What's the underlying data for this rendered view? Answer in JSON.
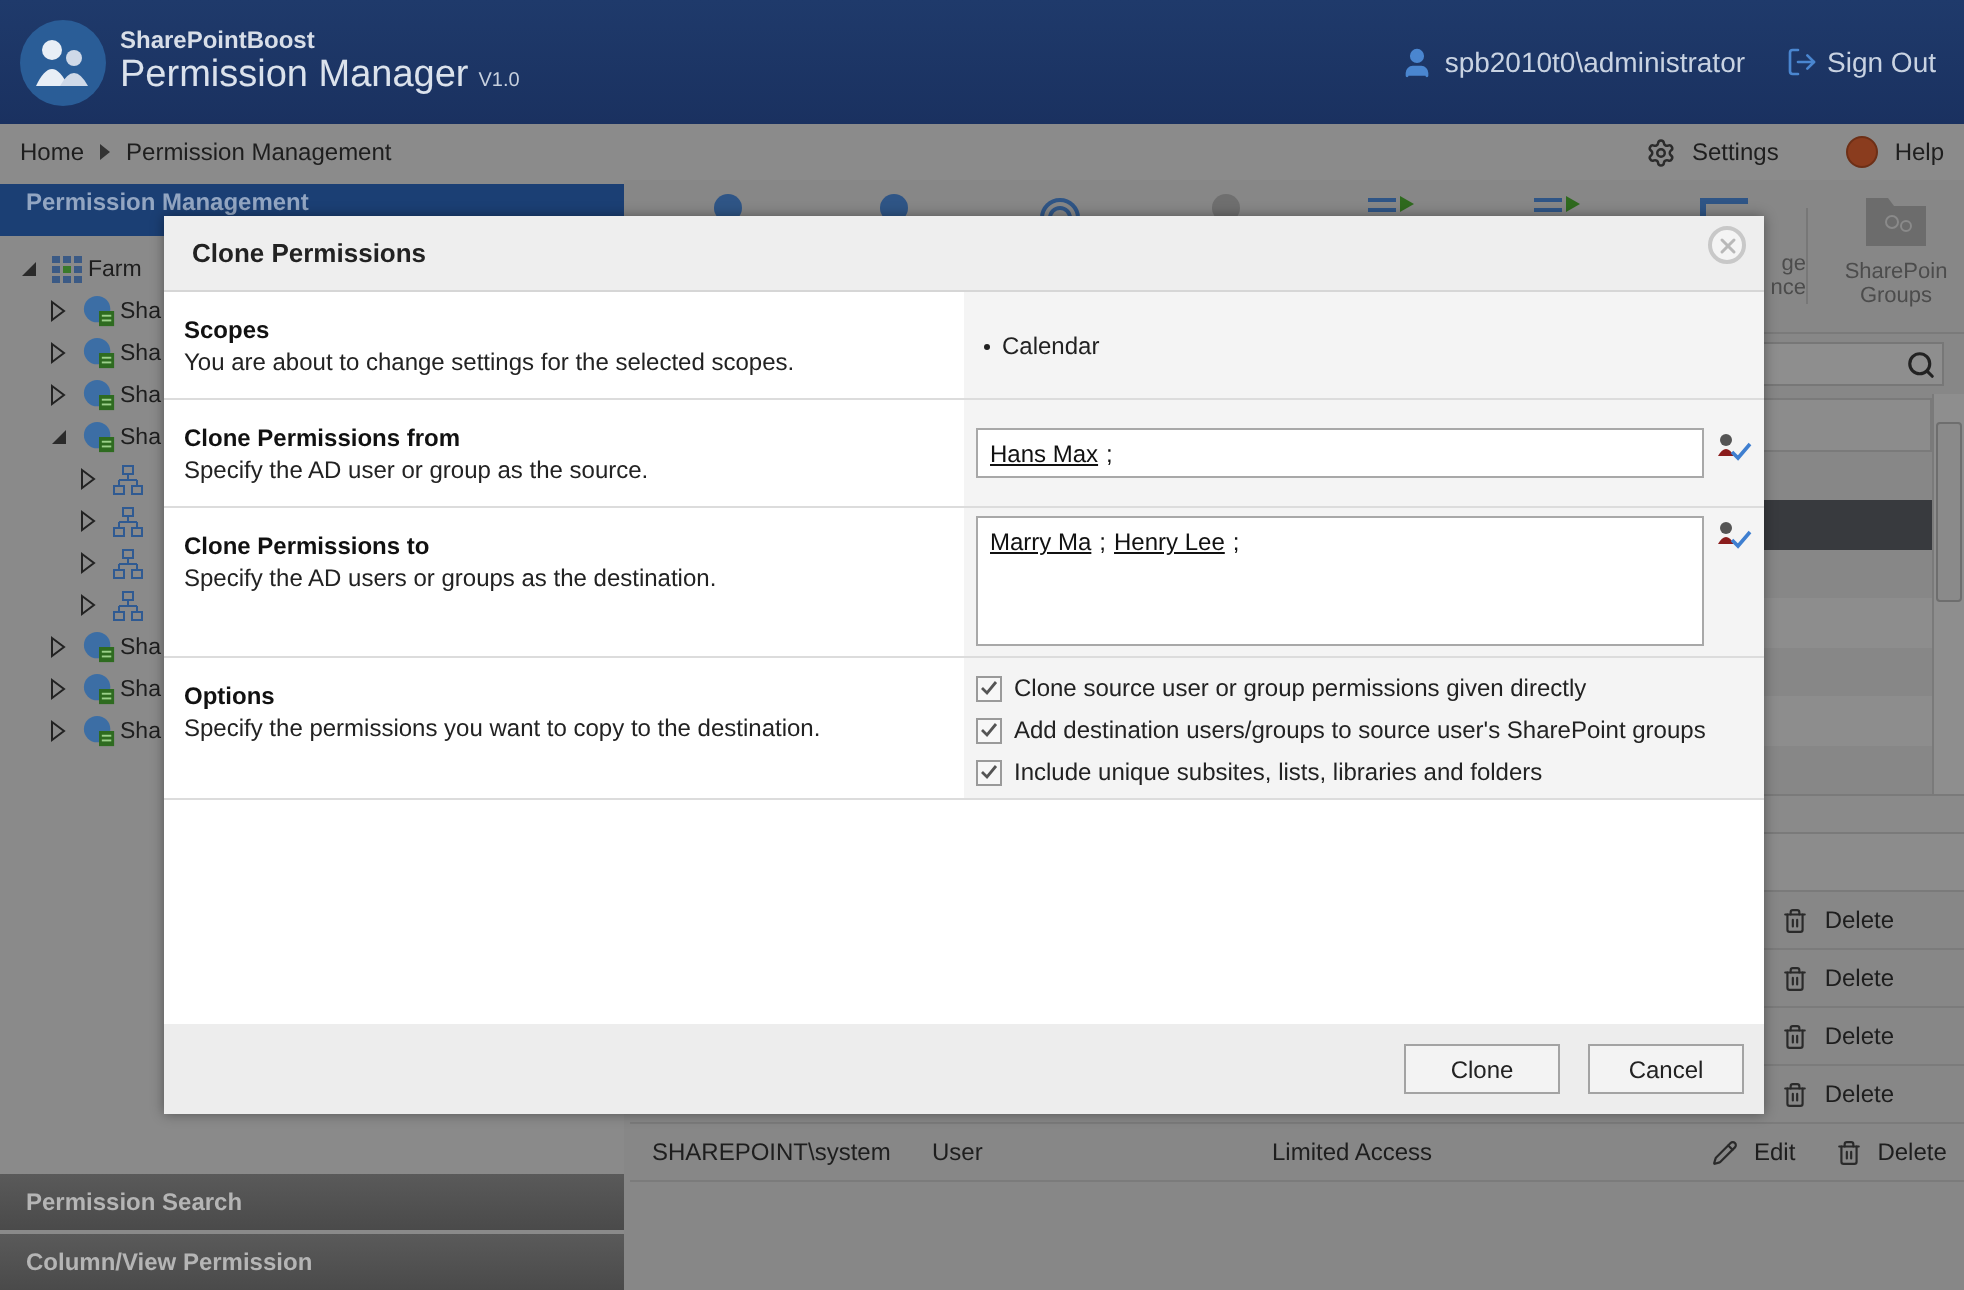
{
  "header": {
    "brand": "SharePointBoost",
    "title": "Permission Manager",
    "version": "V1.0",
    "user": "spb2010t0\\administrator",
    "sign_out": "Sign Out"
  },
  "breadcrumb": {
    "items": [
      "Home",
      "Permission Management"
    ],
    "settings": "Settings",
    "help": "Help"
  },
  "sidebar": {
    "title": "Permission Management",
    "tree": {
      "label": "Farm",
      "kind": "farm",
      "expanded": true,
      "children": [
        {
          "label": "Sha",
          "kind": "site",
          "expanded": false
        },
        {
          "label": "Sha",
          "kind": "site",
          "expanded": false
        },
        {
          "label": "Sha",
          "kind": "site",
          "expanded": false
        },
        {
          "label": "Sha",
          "kind": "site",
          "expanded": true,
          "children": [
            {
              "kind": "web",
              "expanded": false
            },
            {
              "kind": "web",
              "expanded": false
            },
            {
              "kind": "web",
              "expanded": false
            },
            {
              "kind": "web",
              "expanded": false
            }
          ]
        },
        {
          "label": "Sha",
          "kind": "site",
          "expanded": false
        },
        {
          "label": "Sha",
          "kind": "site",
          "expanded": false
        },
        {
          "label": "Sha",
          "kind": "site",
          "expanded": false
        }
      ]
    },
    "panels": [
      "Permission Search",
      "Column/View Permission"
    ]
  },
  "toolbar": {
    "items": [
      {
        "kind": "user"
      },
      {
        "kind": "user"
      },
      {
        "kind": "target"
      },
      {
        "kind": "user-grey"
      },
      {
        "kind": "list"
      },
      {
        "kind": "list"
      },
      {
        "kind": "hierarchy",
        "label": [
          "ge",
          "nce"
        ]
      },
      {
        "kind": "folder",
        "label": [
          "SharePoin",
          "Groups"
        ]
      }
    ]
  },
  "table": {
    "upper_rows": [
      {
        "selected": false
      },
      {
        "selected": true
      },
      {
        "selected": false
      },
      {
        "selected": false
      },
      {
        "selected": false
      },
      {
        "selected": false
      },
      {
        "selected": false
      }
    ],
    "lower_rows": [
      {
        "actions": [
          "Delete"
        ]
      },
      {
        "actions": [
          "Delete"
        ]
      },
      {
        "actions": [
          "Delete"
        ]
      },
      {
        "actions": [
          "Delete"
        ]
      },
      {
        "cells": [
          "SHAREPOINT\\system",
          "User",
          "Limited Access"
        ],
        "actions": [
          "Edit",
          "Delete"
        ]
      }
    ]
  },
  "dialog": {
    "title": "Clone Permissions",
    "sections": [
      {
        "kind": "scopes",
        "title": "Scopes",
        "description": "You are about to change settings for the selected scopes.",
        "items": [
          "Calendar"
        ]
      },
      {
        "kind": "people",
        "title": "Clone Permissions from",
        "description": "Specify the AD user or group as the source.",
        "names": [
          "Hans Max"
        ],
        "separator": ";",
        "multiline": false
      },
      {
        "kind": "people",
        "title": "Clone Permissions to",
        "description": "Specify the AD users or groups as the destination.",
        "names": [
          "Marry Ma",
          "Henry Lee"
        ],
        "separator": ";",
        "multiline": true
      },
      {
        "kind": "options",
        "title": "Options",
        "description": "Specify the permissions you want to copy to the destination.",
        "options": [
          {
            "label": "Clone source user or group permissions given directly",
            "checked": true
          },
          {
            "label": "Add destination users/groups to source user's SharePoint groups",
            "checked": true
          },
          {
            "label": "Include unique subsites, lists, libraries and folders",
            "checked": true
          }
        ]
      }
    ],
    "buttons": [
      "Clone",
      "Cancel"
    ]
  }
}
